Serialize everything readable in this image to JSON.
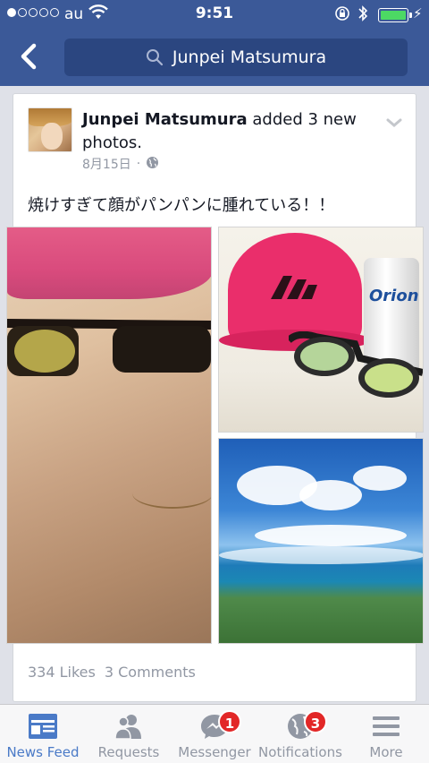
{
  "status_bar": {
    "carrier": "au",
    "time": "9:51"
  },
  "nav": {
    "search_text": "Junpei Matsumura"
  },
  "post": {
    "author": "Junpei Matsumura",
    "action": " added 3 new photos.",
    "date": "8月15日",
    "separator": "·",
    "text": "焼けすぎて顔がパンパンに腫れている！！",
    "likes": "334 Likes",
    "comments": "3 Comments",
    "photo2_can_label": "Orion",
    "photo2_cap_logo": "adidas"
  },
  "tabbar": {
    "items": [
      {
        "label": "News Feed",
        "icon": "news-feed-icon",
        "active": true
      },
      {
        "label": "Requests",
        "icon": "requests-icon"
      },
      {
        "label": "Messenger",
        "icon": "messenger-icon",
        "badge": "1"
      },
      {
        "label": "Notifications",
        "icon": "globe-icon",
        "badge": "3"
      },
      {
        "label": "More",
        "icon": "menu-icon"
      }
    ]
  },
  "colors": {
    "brand": "#3b5998",
    "search_bg": "#2b4680",
    "badge": "#e22727",
    "active_tab": "#4a7ac7",
    "battery": "#4cd964"
  }
}
